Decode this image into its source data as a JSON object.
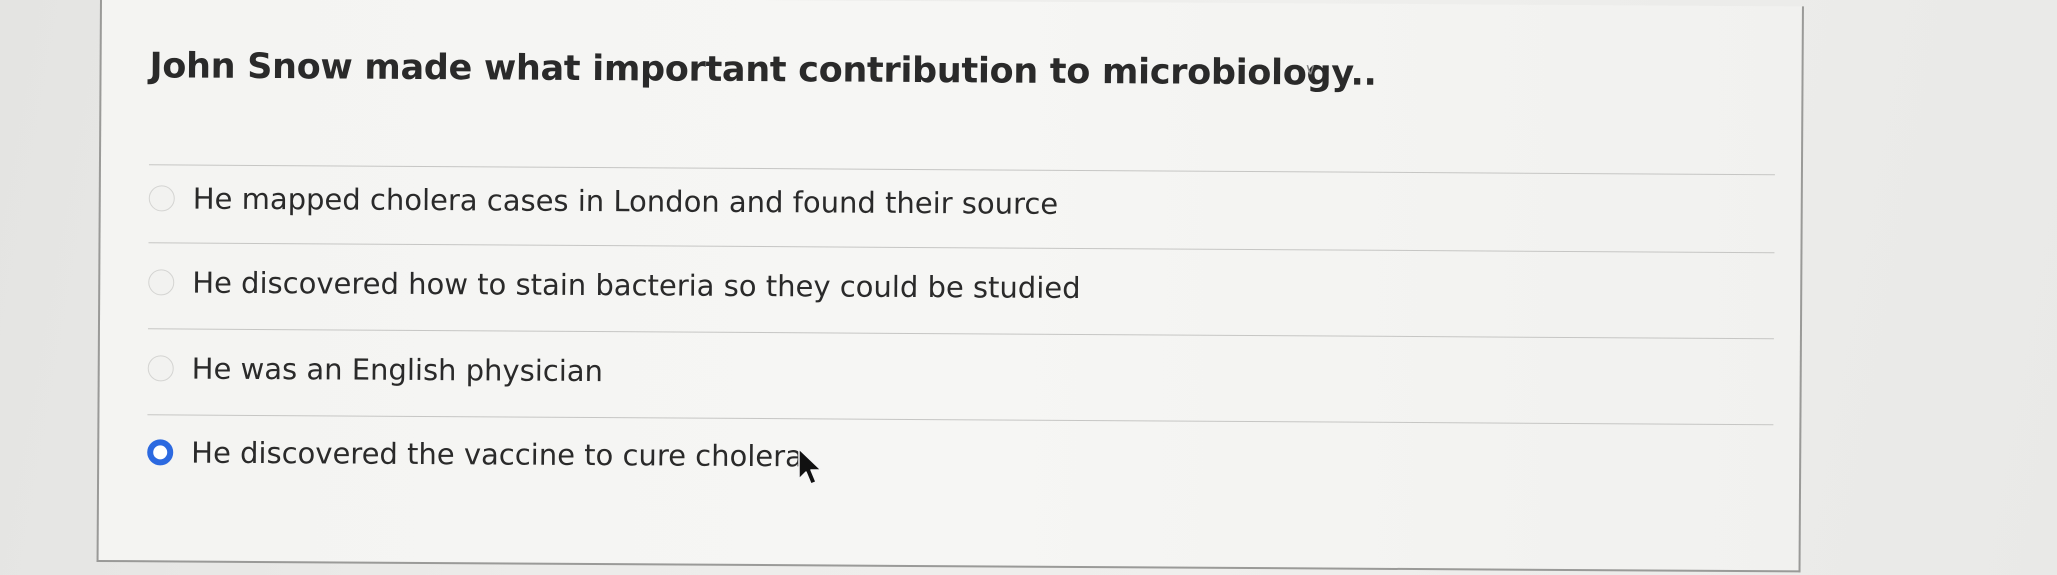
{
  "question": {
    "text": "John Snow made what important contribution to microbiology.."
  },
  "collapse_icon": "chevron-down-icon",
  "options": [
    {
      "label": "He mapped cholera cases in London and found their source",
      "selected": false
    },
    {
      "label": "He discovered how to stain bacteria so they could be studied",
      "selected": false
    },
    {
      "label": "He was an English physician",
      "selected": false
    },
    {
      "label": "He discovered the vaccine to cure cholera",
      "selected": true
    }
  ],
  "colors": {
    "radio_selected": "#2c69e0",
    "text": "#2a2a2a",
    "divider": "#c6c6c4"
  },
  "pointer_icon": "mouse-pointer-icon"
}
